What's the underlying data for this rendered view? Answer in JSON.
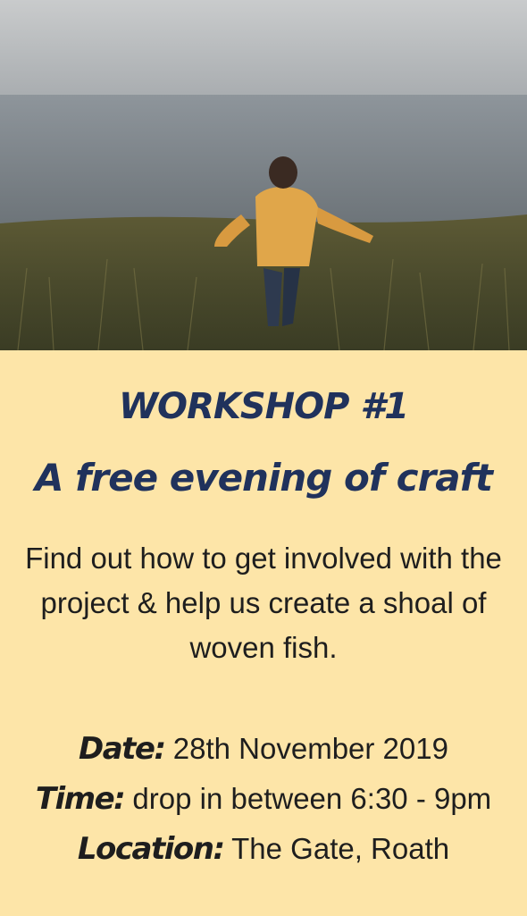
{
  "workshop": {
    "title": "WORKSHOP #1",
    "subtitle": "A free evening of craft",
    "description": "Find out how to get involved with the project & help us create a shoal of woven fish.",
    "date_label": "Date:",
    "date_value": "28th November 2019",
    "time_label": "Time:",
    "time_value": "drop in between 6:30 - 9pm",
    "location_label": "Location:",
    "location_value": "The Gate, Roath"
  },
  "colors": {
    "background": "#fde5a8",
    "heading": "#20325c",
    "body_text": "#1e1e1e",
    "jacket": "#e0a64a"
  }
}
